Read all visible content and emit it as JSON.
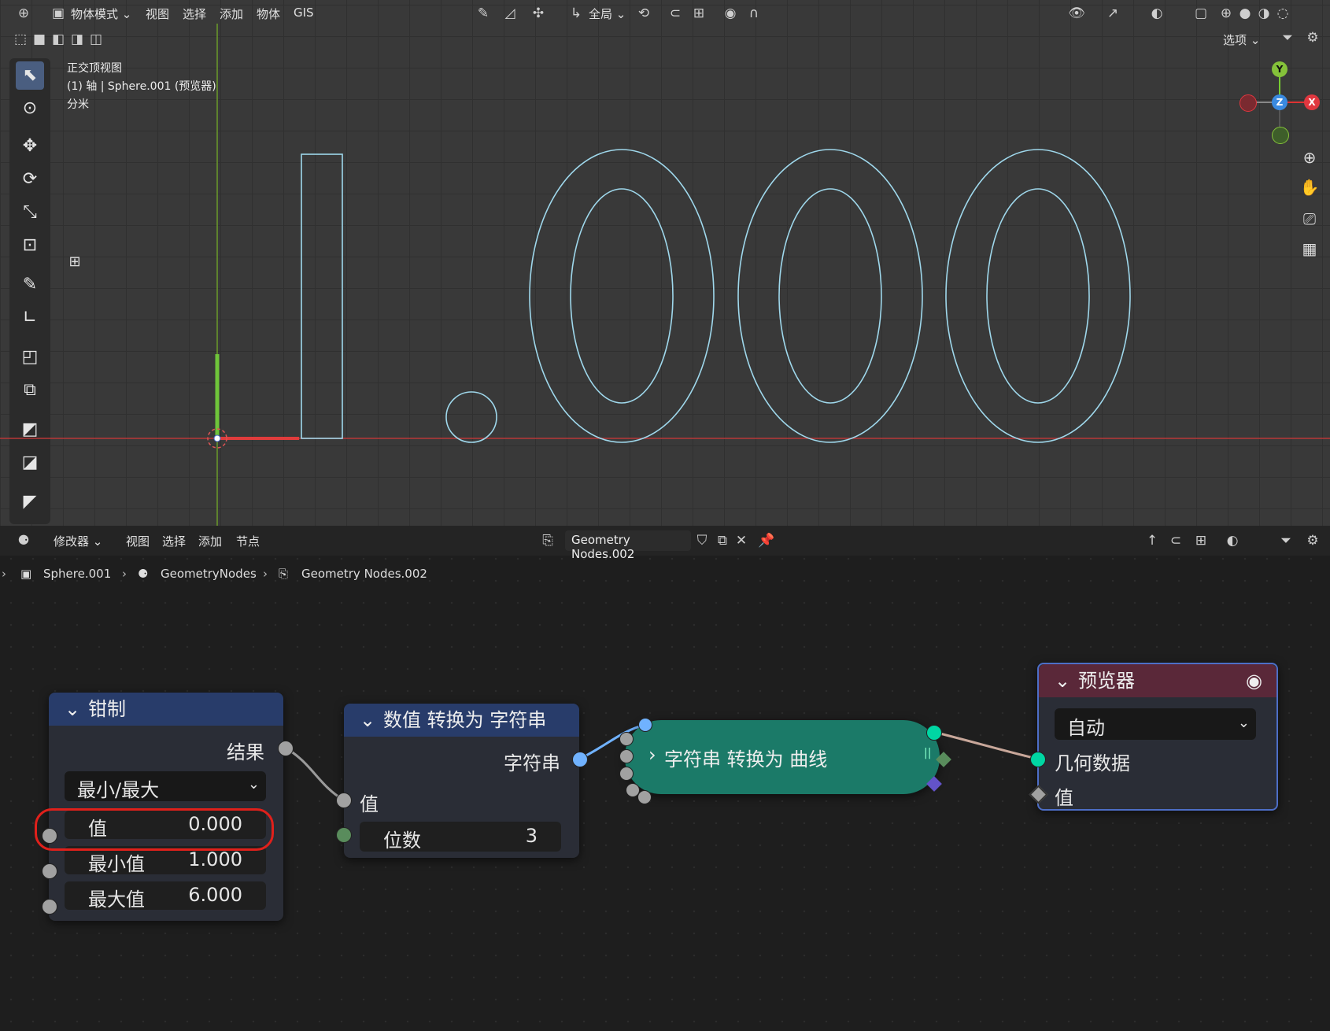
{
  "top_header": {
    "mode_label": "物体模式",
    "menus": [
      "视图",
      "选择",
      "添加",
      "物体",
      "GIS"
    ],
    "transform_orientation": "全局",
    "options_label": "选项"
  },
  "viewport": {
    "view_name": "正交顶视图",
    "collection_info": "(1) 轴 | Sphere.001 (预览器)",
    "unit_label": "分米",
    "gizmo": {
      "y": "Y",
      "z": "Z",
      "x": "X"
    },
    "displayed_text": "1.000"
  },
  "node_header": {
    "editor_type": "修改器",
    "menus": [
      "视图",
      "选择",
      "添加",
      "节点"
    ],
    "node_group_name": "Geometry Nodes.002"
  },
  "breadcrumb": {
    "object": "Sphere.001",
    "modifier": "GeometryNodes",
    "node_group": "Geometry Nodes.002"
  },
  "nodes": {
    "clamp": {
      "title": "钳制",
      "output_label": "结果",
      "mode": "最小/最大",
      "value_label": "值",
      "value": "0.000",
      "min_label": "最小值",
      "min": "1.000",
      "max_label": "最大值",
      "max": "6.000"
    },
    "value_to_string": {
      "title": "数值 转换为 字符串",
      "output_label": "字符串",
      "value_label": "值",
      "decimals_label": "位数",
      "decimals": "3"
    },
    "string_to_curves": {
      "title": "字符串 转换为 曲线"
    },
    "viewer": {
      "title": "预览器",
      "domain": "自动",
      "geometry_label": "几何数据",
      "value_label": "值"
    }
  },
  "colors": {
    "accent_blue": "#4a5e80",
    "clamp_header": "#283c6a",
    "viewer_header": "#5a2839",
    "string_node": "#1b7a68",
    "socket_float": "#a1a1a1",
    "socket_string": "#70b2ff",
    "socket_geometry": "#00d6a3",
    "socket_int": "#598c5c",
    "highlight": "#e0201b"
  }
}
